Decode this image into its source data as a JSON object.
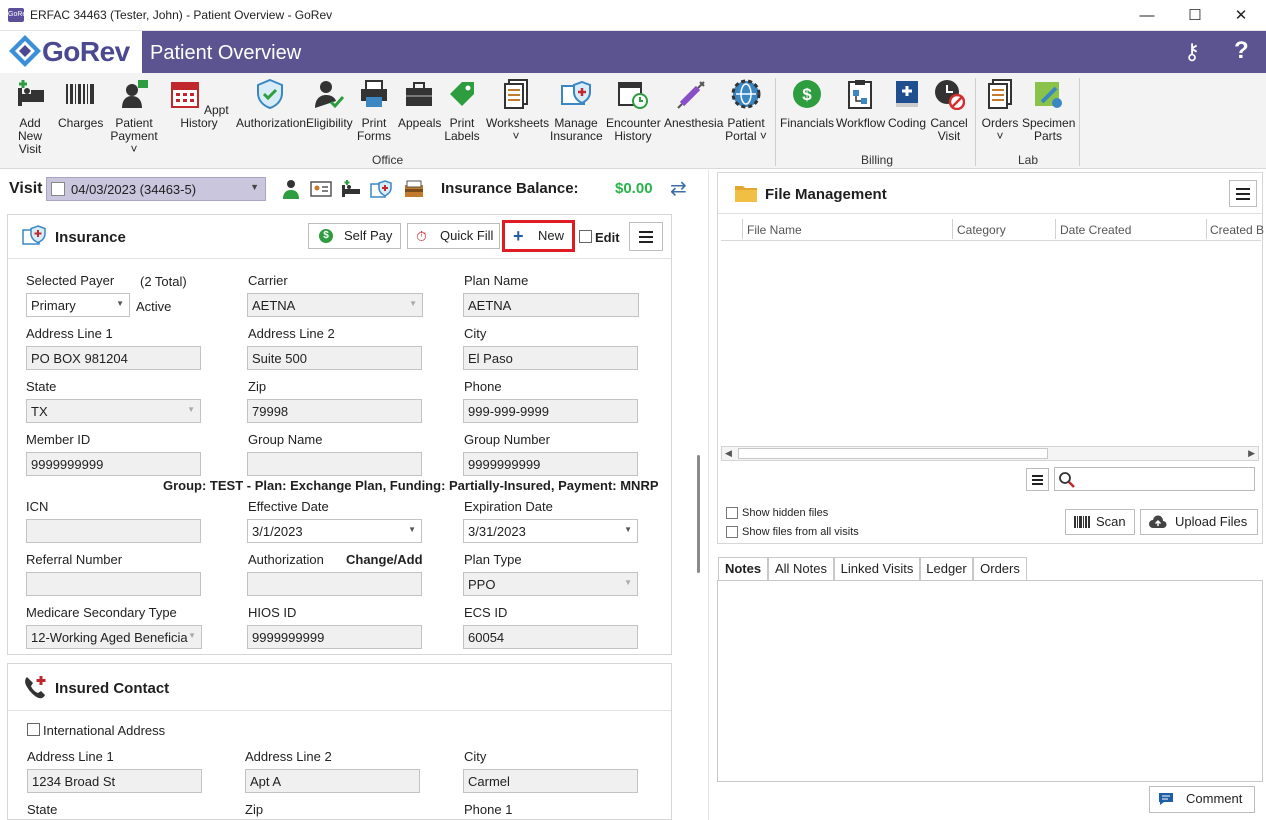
{
  "window": {
    "title": "ERFAC 34463 (Tester, John) - Patient Overview - GoRev",
    "app_icon_text": "GoRev",
    "minimize": "—",
    "maximize": "☐",
    "close": "✕"
  },
  "header": {
    "logo": "GoRev",
    "page_title": "Patient Overview",
    "help": "?"
  },
  "ribbon": {
    "office": [
      {
        "label1": "Add New",
        "label2": "Visit"
      },
      {
        "label1": "Charges",
        "label2": ""
      },
      {
        "label1": "Patient",
        "label2": "Payment ˅"
      },
      {
        "label1": "Appt History",
        "label2": ""
      },
      {
        "label1": "Authorization",
        "label2": ""
      },
      {
        "label1": "Eligibility",
        "label2": ""
      },
      {
        "label1": "Print",
        "label2": "Forms"
      },
      {
        "label1": "Appeals",
        "label2": ""
      },
      {
        "label1": "Print",
        "label2": "Labels"
      },
      {
        "label1": "Worksheets",
        "label2": "˅"
      },
      {
        "label1": "Manage",
        "label2": "Insurance"
      },
      {
        "label1": "Encounter",
        "label2": "History"
      },
      {
        "label1": "Anesthesia",
        "label2": ""
      },
      {
        "label1": "Patient",
        "label2": "Portal ˅"
      }
    ],
    "billing": [
      {
        "label1": "Financials",
        "label2": ""
      },
      {
        "label1": "Workflow",
        "label2": ""
      },
      {
        "label1": "Coding",
        "label2": ""
      },
      {
        "label1": "Cancel",
        "label2": "Visit"
      }
    ],
    "lab": [
      {
        "label1": "Orders",
        "label2": "˅"
      },
      {
        "label1": "Specimen",
        "label2": "Parts"
      }
    ],
    "groups": {
      "office": "Office",
      "billing": "Billing",
      "lab": "Lab"
    }
  },
  "visit_bar": {
    "label": "Visit",
    "selected": "04/03/2023 (34463-5)",
    "insurance_balance_label": "Insurance Balance:",
    "insurance_balance": "$0.00"
  },
  "insurance": {
    "title": "Insurance",
    "self_pay": "Self Pay",
    "quick_fill": "Quick Fill",
    "new": "New",
    "edit": "Edit",
    "labels": {
      "selected_payer": "Selected Payer",
      "total": "(2 Total)",
      "carrier": "Carrier",
      "plan_name": "Plan Name",
      "address1": "Address Line 1",
      "address2": "Address Line 2",
      "city": "City",
      "state": "State",
      "zip": "Zip",
      "phone": "Phone",
      "member_id": "Member ID",
      "group_name": "Group Name",
      "group_number": "Group Number",
      "icn": "ICN",
      "effective_date": "Effective Date",
      "expiration_date": "Expiration Date",
      "referral_number": "Referral Number",
      "authorization": "Authorization",
      "change_add": "Change/Add",
      "plan_type": "Plan Type",
      "medicare_secondary": "Medicare Secondary Type",
      "hios_id": "HIOS ID",
      "ecs_id": "ECS ID"
    },
    "values": {
      "payer": "Primary",
      "status": "Active",
      "carrier": "AETNA",
      "plan_name": "AETNA",
      "address1": "PO BOX 981204",
      "address2": "Suite 500",
      "city": "El Paso",
      "state": "TX",
      "zip": "79998",
      "phone": "999-999-9999",
      "member_id": "9999999999",
      "group_name": "",
      "group_number": "9999999999",
      "icn": "",
      "effective_date": "3/1/2023",
      "expiration_date": "3/31/2023",
      "referral_number": "",
      "authorization": "",
      "plan_type": "PPO",
      "medicare_secondary": "12-Working Aged Beneficia",
      "hios_id": "9999999999",
      "ecs_id": "60054"
    },
    "summary": "Group: TEST - Plan: Exchange Plan, Funding: Partially-Insured, Payment: MNRP"
  },
  "insured_contact": {
    "title": "Insured Contact",
    "international": "International Address",
    "labels": {
      "address1": "Address Line 1",
      "address2": "Address Line 2",
      "city": "City",
      "state": "State",
      "zip": "Zip",
      "phone1": "Phone 1"
    },
    "values": {
      "address1": "1234 Broad St",
      "address2": "Apt A",
      "city": "Carmel"
    }
  },
  "file_management": {
    "title": "File Management",
    "columns": [
      "File Name",
      "Category",
      "Date Created",
      "Created B"
    ],
    "show_hidden": "Show hidden files",
    "show_all_visits": "Show files from all visits",
    "scan": "Scan",
    "upload": "Upload Files"
  },
  "notes": {
    "tabs": [
      "Notes",
      "All Notes",
      "Linked Visits",
      "Ledger",
      "Orders"
    ],
    "comment": "Comment"
  },
  "colors": {
    "header_bg": "#5b5490",
    "balance_green": "#2bb24c",
    "highlight_red": "#e01b22",
    "visit_select_bg": "#c9c6dd"
  }
}
